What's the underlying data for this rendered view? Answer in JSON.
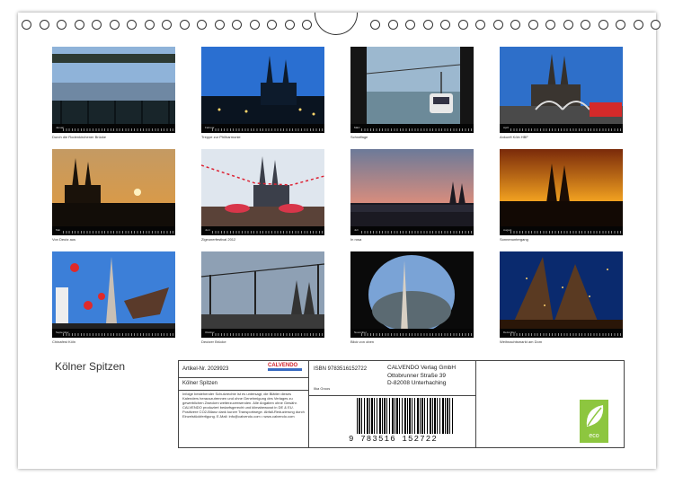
{
  "calendar_title": "Kölner Spitzen",
  "photos": [
    {
      "month": "Januar",
      "caption": "Durch die Rodenkirchener Brücke",
      "icon": "bridge-photo"
    },
    {
      "month": "Februar",
      "caption": "Treppe zur Philharmonie",
      "icon": "cathedral-night-photo"
    },
    {
      "month": "März",
      "caption": "Schraffage",
      "icon": "cable-car-photo"
    },
    {
      "month": "April",
      "caption": "Ankunft Köln HBF",
      "icon": "station-photo"
    },
    {
      "month": "Mai",
      "caption": "Von Deutz aus",
      "icon": "sunset-photo"
    },
    {
      "month": "Juni",
      "caption": "Zigeunerfestival 2012",
      "icon": "festival-photo"
    },
    {
      "month": "Juli",
      "caption": "In rosa",
      "icon": "pink-skyline-photo"
    },
    {
      "month": "August",
      "caption": "Sonnenuntergang",
      "icon": "orange-sunset-photo"
    },
    {
      "month": "September",
      "caption": "Chinafest Köln",
      "icon": "chinafest-photo"
    },
    {
      "month": "Oktober",
      "caption": "Deutzer Brücke",
      "icon": "deutz-bridge-photo"
    },
    {
      "month": "November",
      "caption": "Blick von oben",
      "icon": "view-from-above-photo"
    },
    {
      "month": "Dezember",
      "caption": "Weihnachtsmarkt am Dom",
      "icon": "christmas-market-photo"
    }
  ],
  "info_box": {
    "article": "Artikel-Nr. 2029923",
    "brand": "CALVENDO",
    "title": "Kölner Spitzen",
    "isbn": "ISBN 9783516152722",
    "author": "Ilka Groos",
    "publisher_lines": [
      "CALVENDO Verlag GmbH",
      "Ottobrunner Straße 39",
      "D-82008 Unterhaching"
    ],
    "legal_text": "Infolge bestehender Schutzrechte ist es untersagt, die Blätter dieses Kalenders herauszutrennen und ohne Genehmigung des Verlages zu gewerblichen Zwecken weiterzuverwenden. Alle Angaben ohne Gewähr. CALVENDO produziert bedarfsgerecht und klimabewusst in DE & EU. Positivere CO2-Bilanz dank kurzer Transportwege. Abfall-Reduzierung durch Einzelstückfertigung. E-Mail: info@calvendo.com • www.calvendo.com",
    "barcode_number": "9 783516 152722",
    "eco_label": "eco"
  },
  "colors": {
    "accent_red": "#d0212a",
    "eco_green": "#8dc63f"
  }
}
